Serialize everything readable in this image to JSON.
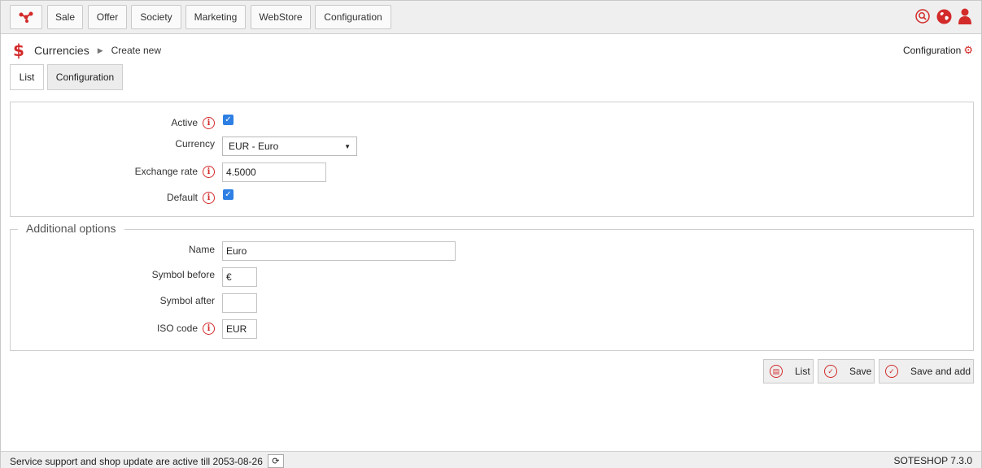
{
  "nav": {
    "logo_icon": "network-logo-icon",
    "items": [
      "Sale",
      "Offer",
      "Society",
      "Marketing",
      "WebStore",
      "Configuration"
    ],
    "right_icons": [
      "search-icon",
      "globe-icon",
      "user-icon"
    ]
  },
  "header": {
    "title": "Currencies",
    "subtitle": "Create new",
    "config_link": "Configuration"
  },
  "tabs": {
    "list": "List",
    "configuration": "Configuration"
  },
  "form": {
    "active_label": "Active",
    "active_checked": true,
    "currency_label": "Currency",
    "currency_value": "EUR - Euro",
    "exchange_rate_label": "Exchange rate",
    "exchange_rate_value": "4.5000",
    "default_label": "Default",
    "default_checked": true
  },
  "additional": {
    "legend": "Additional options",
    "name_label": "Name",
    "name_value": "Euro",
    "symbol_before_label": "Symbol before",
    "symbol_before_value": "€",
    "symbol_after_label": "Symbol after",
    "symbol_after_value": "",
    "iso_label": "ISO code",
    "iso_value": "EUR"
  },
  "actions": {
    "list": "List",
    "save": "Save",
    "save_and_add": "Save and add"
  },
  "footer": {
    "status": "Service support and shop update are active till 2053-08-26",
    "version": "SOTESHOP 7.3.0"
  },
  "colors": {
    "accent": "#d32a2a",
    "checkbox": "#2d7fe3"
  }
}
